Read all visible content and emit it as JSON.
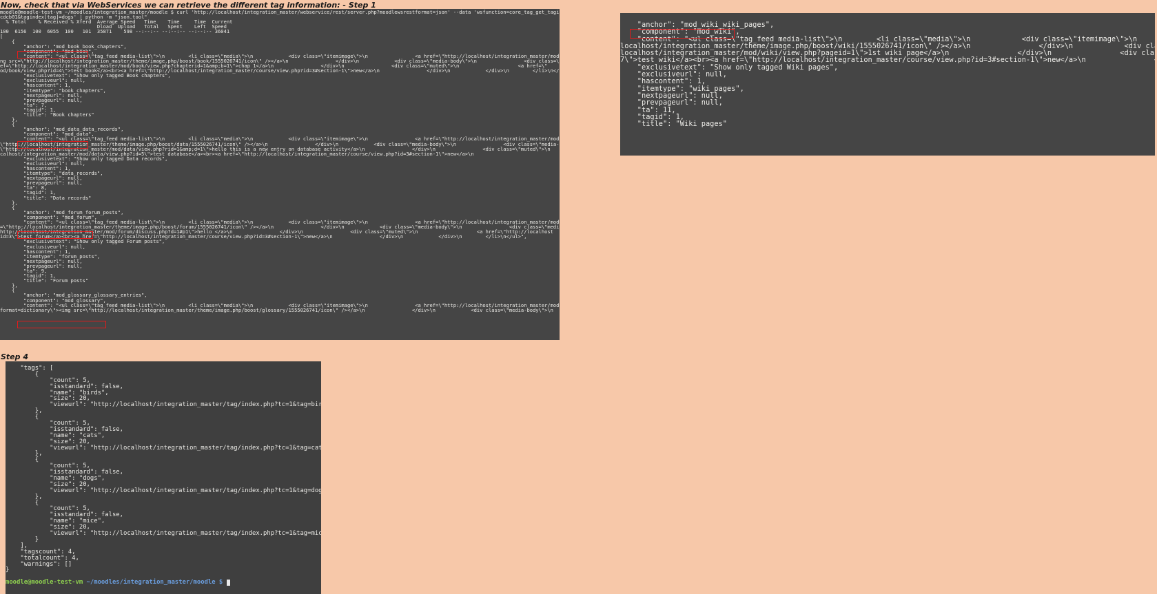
{
  "headings": {
    "step1": "Now, check that via WebServices we can retrieve the different tag information: - Step 1",
    "step4": "Step 4"
  },
  "step1_terminal": {
    "lines": [
      "moodle@moodle-test-vm ~/moodles/integration_master/moodle $ curl 'http://localhost/integration_master/webservice/rest/server.php?moodlewsrestformat=json' --data 'wsfunction=core_tag_get_tagindex_per_a",
      "cdcb01&tagindex[tag]=dogs' | python -m \"json.tool\"",
      "  % Total    % Received % Xferd  Average Speed   Time    Time     Time  Current",
      "                                 Dload  Upload   Total   Spent    Left  Speed",
      "100  6156  100  6055  100   101  35871    598 --:--:-- --:--:-- --:--:-- 36041",
      "[",
      "    {",
      "        \"anchor\": \"mod_book_book_chapters\",",
      "        \"component\": \"mod_book\",",
      "        \"content\": \"<ul class=\\\"tag_feed media-list\\\">\\n        <li class=\\\"media\\\">\\n            <div class=\\\"itemimage\\\">\\n                <a href=\\\"http://localhost/integration_master/mod/b",
      "ng src=\\\"http://localhost/integration_master/theme/image.php/boost/book/1555026741/icon\\\" /></a>\\n                </div>\\n            <div class=\\\"media-body\\\">\\n                <div class=\\\"media-",
      "ef=\\\"http://localhost/integration_master/mod/book/view.php?chapterid=1&amp;b=1\\\">chap 1</a>\\n                </div>\\n                <div class=\\\"muted\\\">\\n                    <a href=\\\"",
      "od/book/view.php?id=4\\\">test book</a><br><a href=\\\"http://localhost/integration_master/course/view.php?id=3#section-1\\\">new</a>\\n                </div>\\n            </div>\\n        </li>\\n</ul>\",",
      "        \"exclusivetext\": \"Show only tagged Book chapters\",",
      "        \"exclusiveurl\": null,",
      "        \"hascontent\": 1,",
      "        \"itemtype\": \"book_chapters\",",
      "        \"nextpageurl\": null,",
      "        \"prevpageurl\": null,",
      "        \"ta\": 7,",
      "        \"tagid\": 1,",
      "        \"title\": \"Book chapters\"",
      "    },",
      "    {",
      "        \"anchor\": \"mod_data_data_records\",",
      "        \"component\": \"mod_data\",",
      "        \"content\": \"<ul class=\\\"tag_feed media-list\\\">\\n        <li class=\\\"media\\\">\\n            <div class=\\\"itemimage\\\">\\n                <a href=\\\"http://localhost/integration_master/mod/d",
      "\\\"http://localhost/integration_master/theme/image.php/boost/data/1555026741/icon\\\" /></a>\\n                </div>\\n            <div class=\\\"media-body\\\">\\n                <div class=\\\"media-headi",
      "\\\"http://localhost/integration_master/mod/data/view.php?rid=1&amp;d=1\\\">hello this is a new entry on database activity</a>\\n                </div>\\n                <div class=\\\"muted\\\">\\n",
      "calhost/integration_master/mod/data/view.php?id=5\\\">test database</a><br><a href=\\\"http://localhost/integration_master/course/view.php?id=3#section-1\\\">new</a>\\n",
      "        \"exclusivetext\": \"Show only tagged Data records\",",
      "        \"exclusiveurl\": null,",
      "        \"hascontent\": 1,",
      "        \"itemtype\": \"data_records\",",
      "        \"nextpageurl\": null,",
      "        \"prevpageurl\": null,",
      "        \"ta\": 8,",
      "        \"tagid\": 1,",
      "        \"title\": \"Data records\"",
      "    },",
      "    {",
      "        \"anchor\": \"mod_forum_forum_posts\",",
      "        \"component\": \"mod_forum\",",
      "        \"content\": \"<ul class=\\\"tag_feed media-list\\\">\\n        <li class=\\\"media\\\">\\n            <div class=\\\"itemimage\\\">\\n                <a href=\\\"http://localhost/integration_master/mod/f",
      "=\\\"http://localhost/integration_master/theme/image.php/boost/forum/1555026741/icon\\\" /></a>\\n                </div>\\n            <div class=\\\"media-body\\\">\\n                <div class=\\\"media-heading",
      "http://localhost/integration_master/mod/forum/discuss.php?d=1#p1\\\">hello </a>\\n                </div>\\n                <div class=\\\"muted\\\">\\n                    <a href=\\\"http://localhost",
      "id=3\\\">test forum</a><br><a href=\\\"http://localhost/integration_master/course/view.php?id=3#section-1\\\">new</a>\\n                </div>\\n            </div>\\n        </li>\\n</ul>\",",
      "        \"exclusivetext\": \"Show only tagged Forum posts\",",
      "        \"exclusiveurl\": null,",
      "        \"hascontent\": 1,",
      "        \"itemtype\": \"forum_posts\",",
      "        \"nextpageurl\": null,",
      "        \"prevpageurl\": null,",
      "        \"ta\": 9,",
      "        \"tagid\": 1,",
      "        \"title\": \"Forum posts\"",
      "    },",
      "    {",
      "        \"anchor\": \"mod_glossary_glossary_entries\",",
      "        \"component\": \"mod_glossary\",",
      "        \"content\": \"<ul class=\\\"tag_feed media-list\\\">\\n        <li class=\\\"media\\\">\\n            <div class=\\\"itemimage\\\">\\n                <a href=\\\"http://localhost/integration_master/mod/g",
      "format=dictionary\\\"><img src=\\\"http://localhost/integration_master/theme/image.php/boost/glossary/1555026741/icon\\\" /></a>\\n                </div>\\n            <div class=\\\"media-body\\\">\\n"
    ]
  },
  "wiki_terminal": {
    "lines": [
      "    \"anchor\": \"mod_wiki_wiki_pages\",",
      "    \"component\": \"mod_wiki\",",
      "    \"content\": \"<ul class=\\\"tag_feed media-list\\\">\\n        <li class=\\\"media\\\">\\n            <div class=\\\"itemimage\\\">\\n                <a",
      "localhost/integration_master/theme/image.php/boost/wiki/1555026741/icon\\\" /></a>\\n                </div>\\n            <div class=\\\"media-body\\\">\\n",
      "localhost/integration_master/mod/wiki/view.php?pageid=1\\\">1st wiki page</a>\\n                </div>\\n                <div class=\\\"muted\\\">\\n",
      "7\\\">test wiki</a><br><a href=\\\"http://localhost/integration_master/course/view.php?id=3#section-1\\\">new</a>\\n                </div>\\n",
      "    \"exclusivetext\": \"Show only tagged Wiki pages\",",
      "    \"exclusiveurl\": null,",
      "    \"hascontent\": 1,",
      "    \"itemtype\": \"wiki_pages\",",
      "    \"nextpageurl\": null,",
      "    \"prevpageurl\": null,",
      "    \"ta\": 11,",
      "    \"tagid\": 1,",
      "    \"title\": \"Wiki pages\""
    ]
  },
  "step4_terminal": {
    "lines": [
      "    \"tags\": [",
      "        {",
      "            \"count\": 5,",
      "            \"isstandard\": false,",
      "            \"name\": \"birds\",",
      "            \"size\": 20,",
      "            \"viewurl\": \"http://localhost/integration_master/tag/index.php?tc=1&tag=birds\"",
      "        },",
      "        {",
      "            \"count\": 5,",
      "            \"isstandard\": false,",
      "            \"name\": \"cats\",",
      "            \"size\": 20,",
      "            \"viewurl\": \"http://localhost/integration_master/tag/index.php?tc=1&tag=cats\"",
      "        },",
      "        {",
      "            \"count\": 5,",
      "            \"isstandard\": false,",
      "            \"name\": \"dogs\",",
      "            \"size\": 20,",
      "            \"viewurl\": \"http://localhost/integration_master/tag/index.php?tc=1&tag=dogs\"",
      "        },",
      "        {",
      "            \"count\": 5,",
      "            \"isstandard\": false,",
      "            \"name\": \"mice\",",
      "            \"size\": 20,",
      "            \"viewurl\": \"http://localhost/integration_master/tag/index.php?tc=1&tag=mice\"",
      "        }",
      "    ],",
      "    \"tagscount\": 4,",
      "    \"totalcount\": 4,",
      "    \"warnings\": []",
      "}"
    ],
    "prompt_user": "moodle@moodle-test-vm",
    "prompt_path": "~/moodles/integration_master/moodle $"
  },
  "colors": {
    "background": "#f7c8a9",
    "terminal": "#454545",
    "highlight_box": "#e31b1b",
    "prompt_user": "#8fd14f",
    "prompt_path": "#6b9fe0"
  }
}
